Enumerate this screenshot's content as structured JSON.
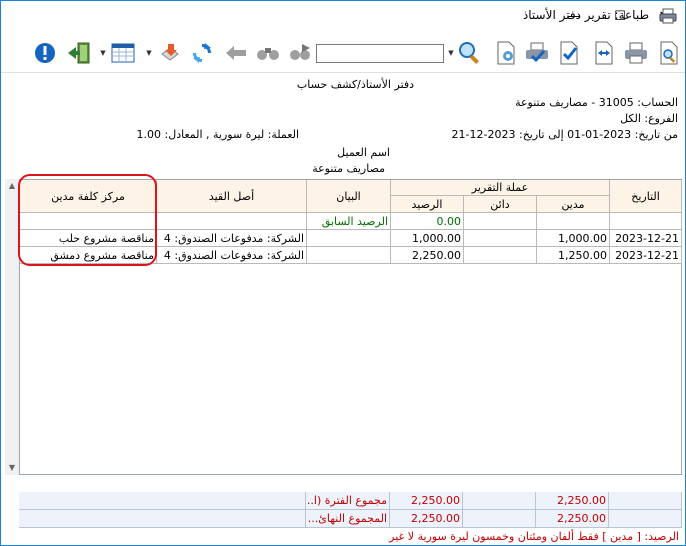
{
  "window": {
    "title": "طباعة: تقرير دفتر الأستاذ",
    "minimize_glyph": "—",
    "maximize_glyph": "☐",
    "close_glyph": "✕"
  },
  "toolbar": {
    "search_value": "",
    "icons": [
      "help-icon",
      "exit-icon",
      "grid-layout-icon",
      "export-icon",
      "refresh-icon",
      "back-icon",
      "binoculars-icon",
      "find-next-icon",
      "search-icon",
      "page-setup-icon",
      "print-setup-icon",
      "check-icon",
      "fit-width-icon",
      "printer-icon",
      "print-preview-icon"
    ]
  },
  "report": {
    "heading": "دفتر الأستاذ/كشف حساب",
    "account": "الحساب: 31005 - مصاريف متنوعة",
    "branches": "الفروع: الكل",
    "date_range": "من تاريخ: 2023-01-01  إلى تاريخ: 2023-12-21",
    "currency": "العملة: ليرة سورية , المعادل: 1.00",
    "customer_name": "اسم العميل",
    "customer_value": "مصاريف متنوعة"
  },
  "grid": {
    "headers": {
      "date": "التاريخ",
      "report_currency": "عملة التقرير",
      "debit": "مدين",
      "credit": "دائن",
      "balance": "الرصيد",
      "statement": "البيان",
      "entry_origin": "أصل القيد",
      "cost_center": "مركز كلفة مدين"
    },
    "previous_balance_row": {
      "balance": "0.00",
      "statement": "الرصيد السابق"
    },
    "rows": [
      {
        "date": "2023-12-21",
        "debit": "1,000.00",
        "credit": "",
        "balance": "1,000.00",
        "statement": "",
        "entry_origin": "الشركة: مدفوعات الصندوق: 4",
        "cost_center": "مناقصة مشروع حلب"
      },
      {
        "date": "2023-12-21",
        "debit": "1,250.00",
        "credit": "",
        "balance": "2,250.00",
        "statement": "",
        "entry_origin": "الشركة: مدفوعات الصندوق: 4",
        "cost_center": "مناقصة مشروع دمشق"
      }
    ]
  },
  "footer": {
    "period_total_label": "مجموع الفترة (ا...",
    "period_total_debit": "2,250.00",
    "period_total_balance": "2,250.00",
    "final_total_label": "المجموع النهائ...",
    "final_total_debit": "2,250.00",
    "final_total_balance": "2,250.00",
    "balance_text": "الرصيد: [ مدين ] فقط ألفان ومئتان وخمسون ليرة سورية لا غير"
  },
  "colors": {
    "header_bg": "#fdf3e7",
    "footer_bg": "#eef3fb",
    "total_text": "#c00000",
    "previous_balance_text": "#007000",
    "highlight": "#e0121b"
  }
}
